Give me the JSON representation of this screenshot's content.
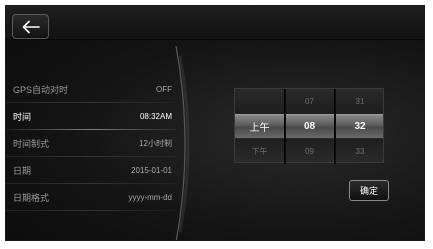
{
  "header": {
    "back_icon": "back-arrow-icon"
  },
  "settings": {
    "items": [
      {
        "label": "GPS自动对时",
        "value": "OFF"
      },
      {
        "label": "时间",
        "value": "08:32AM"
      },
      {
        "label": "时间制式",
        "value": "12小时制"
      },
      {
        "label": "日期",
        "value": "2015-01-01"
      },
      {
        "label": "日期格式",
        "value": "yyyy-mm-dd"
      }
    ],
    "active_index": 1
  },
  "picker": {
    "ampm": {
      "above": "",
      "selected": "上午",
      "below": "下午"
    },
    "hour": {
      "above": "07",
      "selected": "08",
      "below": "09"
    },
    "minute": {
      "above": "31",
      "selected": "32",
      "below": "33"
    }
  },
  "actions": {
    "confirm_label": "确定"
  }
}
